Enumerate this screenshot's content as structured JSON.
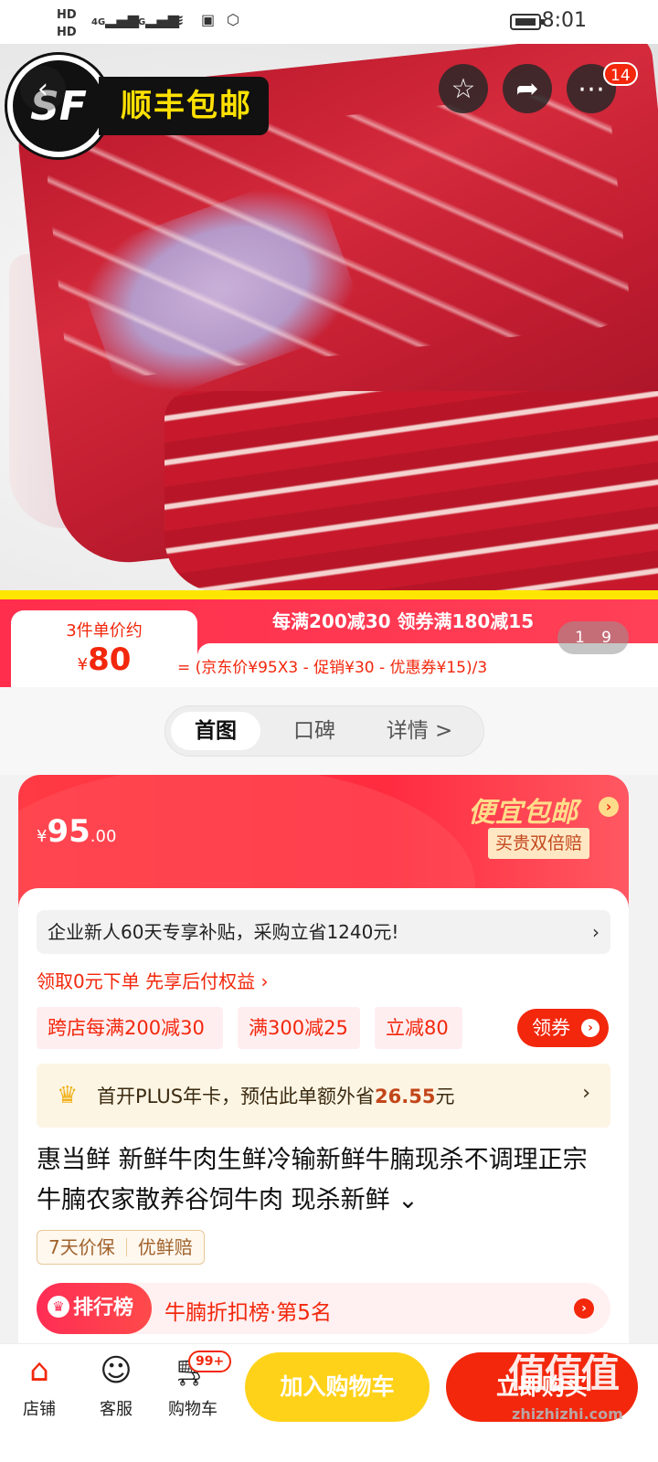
{
  "status": {
    "hd1": "HD",
    "hd2": "HD",
    "net1": "4G",
    "net2": "4G",
    "time": "8:01"
  },
  "hero": {
    "sf_logo": "SF",
    "sf_label": "顺丰包邮",
    "menu_badge": "14",
    "pager_current": "1",
    "pager_total": "9"
  },
  "price_strip": {
    "unit_label": "3件单价约",
    "unit_currency": "¥",
    "unit_price": "80",
    "promo_line": "每满200减30 领券满180减15",
    "formula": "= (京东价¥95X3 - 促销¥30 - 优惠券¥15)/3"
  },
  "tabs": [
    {
      "label": "首图"
    },
    {
      "label": "口碑"
    },
    {
      "label": "详情 >"
    }
  ],
  "price_card": {
    "currency": "¥",
    "price_main": "95",
    "price_decimal": ".00",
    "cheap_label": "便宜包邮",
    "double_pay": "买贵双倍赔"
  },
  "subsidy": {
    "text": "企业新人60天专享补贴，采购立省1240元!",
    "chevron": "›"
  },
  "pay_later": "领取0元下单 先享后付权益 ›",
  "coupons": {
    "chips": [
      "跨店每满200减30",
      "满300减25",
      "立减80"
    ],
    "button": "领券"
  },
  "plus": {
    "prefix": "首开PLUS年卡，预估此单额外省",
    "amount": "26.55",
    "suffix": "元",
    "chevron": "›"
  },
  "product": {
    "title": "惠当鲜 新鲜牛肉生鲜冷输新鲜牛腩现杀不调理正宗牛腩农家散养谷饲牛肉 现杀新鲜 ⌄",
    "tags": [
      "7天价保",
      "优鲜赔"
    ]
  },
  "ranking": {
    "label": "排行榜",
    "text": "牛腩折扣榜·第5名"
  },
  "bottom_bar": {
    "shop": "店铺",
    "service": "客服",
    "cart": "购物车",
    "cart_badge": "99+",
    "add_cart": "加入购物车",
    "buy_now": "立即购买"
  },
  "watermark": {
    "text": "值值值",
    "url": "zhizhizhi.com"
  },
  "colors": {
    "brand_red": "#f2270c",
    "gold": "#ffd21a",
    "sf_yellow": "#ffe100"
  }
}
